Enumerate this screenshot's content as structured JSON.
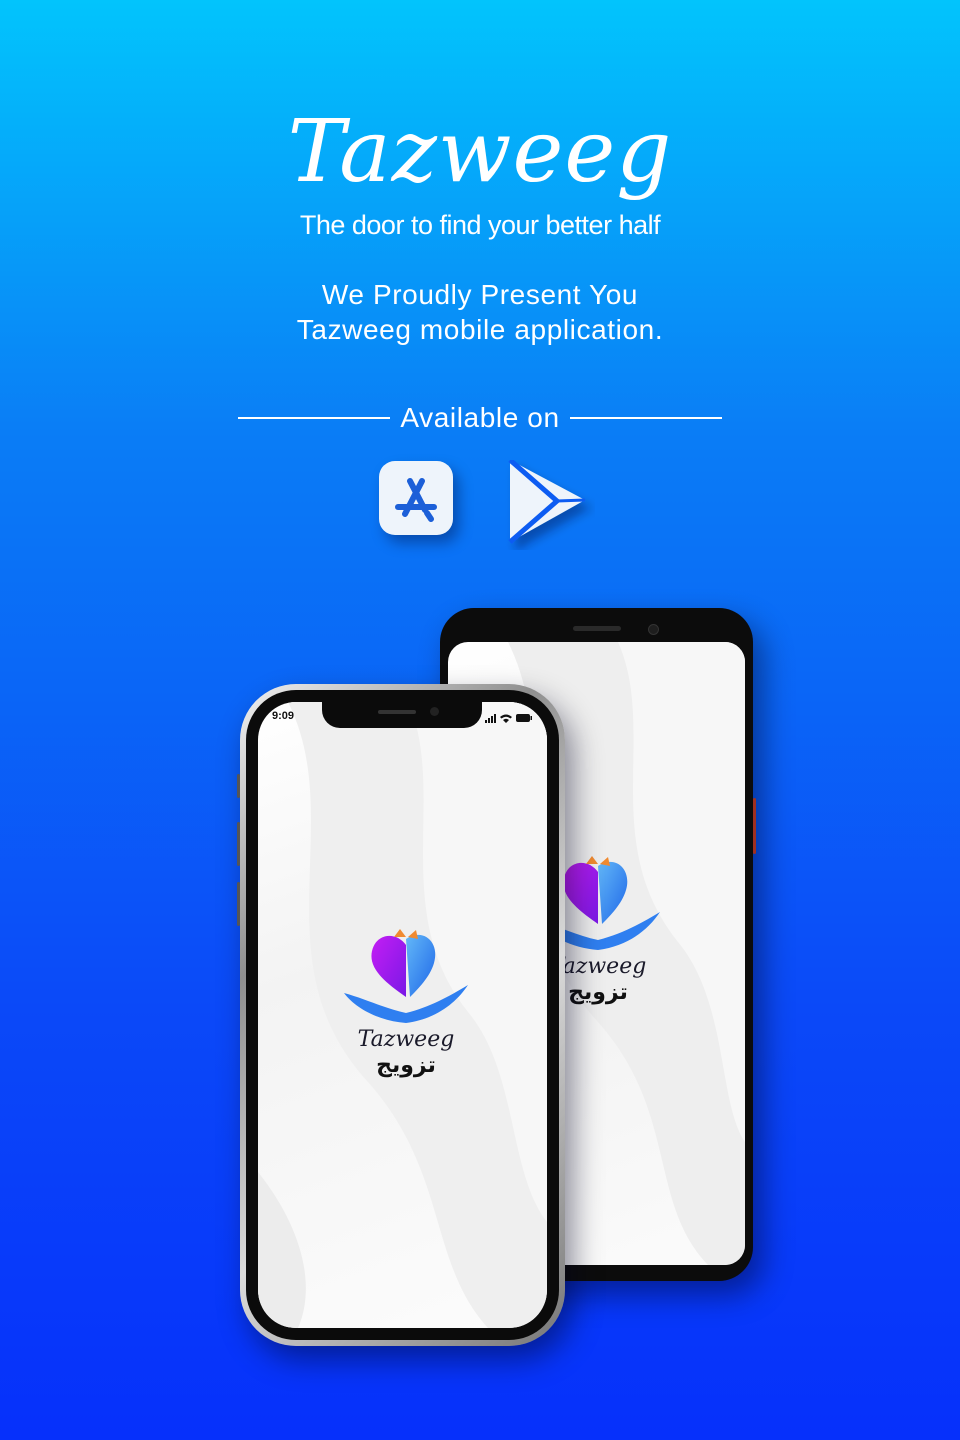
{
  "hero": {
    "brand": "Tazweeg",
    "tagline": "The door to find your better half",
    "intro_line1": "We Proudly Present You",
    "intro_line2": "Tazweeg  mobile application."
  },
  "availability": {
    "label": "Available on",
    "stores": [
      {
        "name": "app-store",
        "icon": "app-store-icon"
      },
      {
        "name": "google-play",
        "icon": "google-play-icon"
      }
    ]
  },
  "phone_front": {
    "status_time": "9:09",
    "logo_word": "Tazweeg",
    "logo_arabic": "تزويج"
  },
  "phone_back": {
    "logo_word": "Tazweeg",
    "logo_arabic": "تزويج"
  },
  "colors": {
    "bg_top": "#02c4fc",
    "bg_bottom": "#0630fb",
    "accent_purple": "#b31ef0",
    "accent_blue": "#2f7ff0",
    "accent_orange": "#f08a30"
  }
}
